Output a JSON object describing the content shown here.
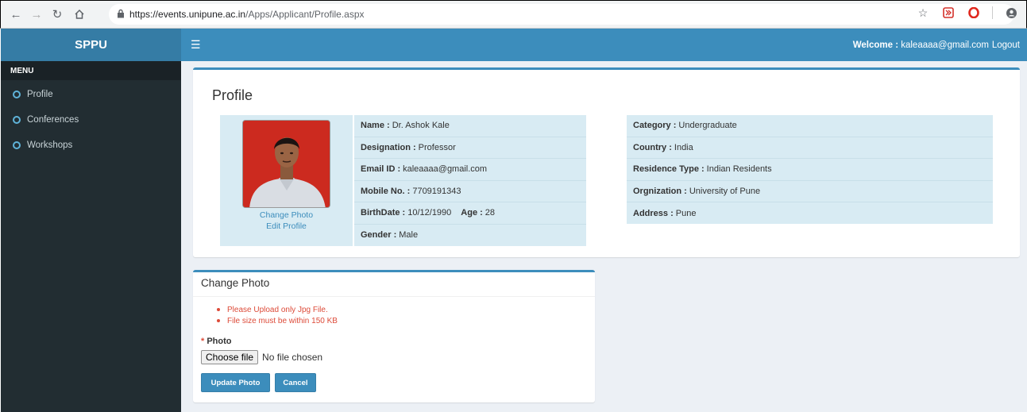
{
  "browser": {
    "url_base": "https://events.unipune.ac.in",
    "url_path": "/Apps/Applicant/Profile.aspx"
  },
  "brand": "SPPU",
  "header": {
    "welcome_label": "Welcome :",
    "welcome_email": "kaleaaaa@gmail.com",
    "logout": "Logout"
  },
  "sidebar": {
    "menu_header": "MENU",
    "items": [
      {
        "label": "Profile"
      },
      {
        "label": "Conferences"
      },
      {
        "label": "Workshops"
      }
    ]
  },
  "profile": {
    "title": "Profile",
    "change_photo": "Change Photo",
    "edit_profile": "Edit Profile",
    "left": [
      {
        "label": "Name :",
        "value": "Dr. Ashok Kale"
      },
      {
        "label": "Designation :",
        "value": "Professor"
      },
      {
        "label": "Email ID :",
        "value": "kaleaaaa@gmail.com"
      },
      {
        "label": "Mobile No. :",
        "value": "7709191343"
      },
      {
        "label": "BirthDate :",
        "value": "10/12/1990"
      },
      {
        "label": "Gender :",
        "value": "Male"
      }
    ],
    "age_label": "Age :",
    "age_value": "28",
    "right": [
      {
        "label": "Category :",
        "value": "Undergraduate"
      },
      {
        "label": "Country :",
        "value": "India"
      },
      {
        "label": "Residence Type :",
        "value": "Indian Residents"
      },
      {
        "label": "Orgnization :",
        "value": "University of Pune"
      },
      {
        "label": "Address :",
        "value": "Pune"
      }
    ]
  },
  "change_photo_box": {
    "title": "Change Photo",
    "rules": [
      "Please Upload only Jpg File.",
      "File size must be within 150 KB"
    ],
    "required_mark": "*",
    "photo_label": "Photo",
    "choose_file": "Choose file",
    "no_file": "No file chosen",
    "update_button": "Update Photo",
    "cancel_button": "Cancel"
  },
  "colors": {
    "primary": "#3c8dbc",
    "sidebar": "#222d32",
    "danger": "#dd4b39",
    "info_bg": "#d8ebf3"
  }
}
